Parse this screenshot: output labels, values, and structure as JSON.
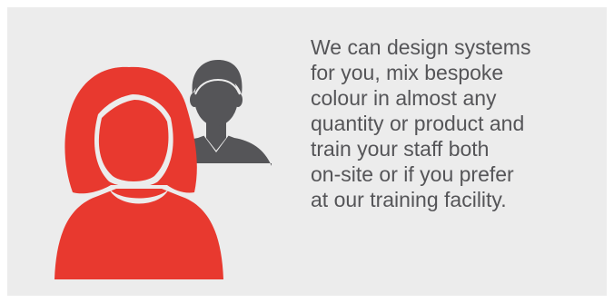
{
  "colors": {
    "panel_background": "#ececec",
    "woman_figure": "#e8392f",
    "man_figure": "#555558",
    "text": "#555558"
  },
  "illustration": {
    "woman_icon": "female-user-icon",
    "man_icon": "male-user-icon"
  },
  "message": {
    "lines": [
      "We can design systems",
      "for you, mix bespoke",
      "colour in almost any",
      "quantity or product and",
      "train your staff both",
      "on-site or if you prefer",
      "at our training facility."
    ]
  }
}
